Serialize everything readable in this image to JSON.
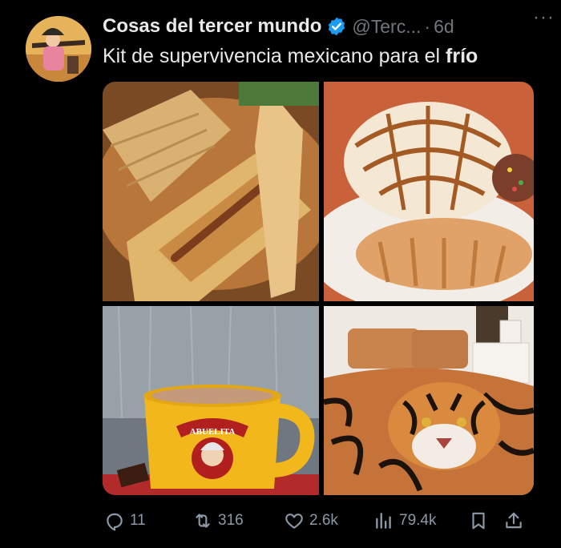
{
  "colors": {
    "background": "#000000",
    "text_primary": "#e7e9ea",
    "text_secondary": "#71767b",
    "verified_blue": "#1d9bf0",
    "action_gray": "#8b98a5"
  },
  "tweet": {
    "author_name": "Cosas del tercer mundo",
    "handle": "@Terc...",
    "separator": "·",
    "time": "6d",
    "more_label": "···",
    "text_before": "Kit de supervivencia mexicano para el ",
    "text_bold": "frío",
    "images": [
      {
        "icon": "tamales-photo"
      },
      {
        "icon": "conchas-bread-photo"
      },
      {
        "icon": "abuelita-chocolate-mug-photo",
        "mug_label": "ABUELITA"
      },
      {
        "icon": "tiger-blanket-bed-photo"
      }
    ]
  },
  "actions": {
    "replies": "11",
    "retweets": "316",
    "likes": "2.6k",
    "views": "79.4k"
  }
}
